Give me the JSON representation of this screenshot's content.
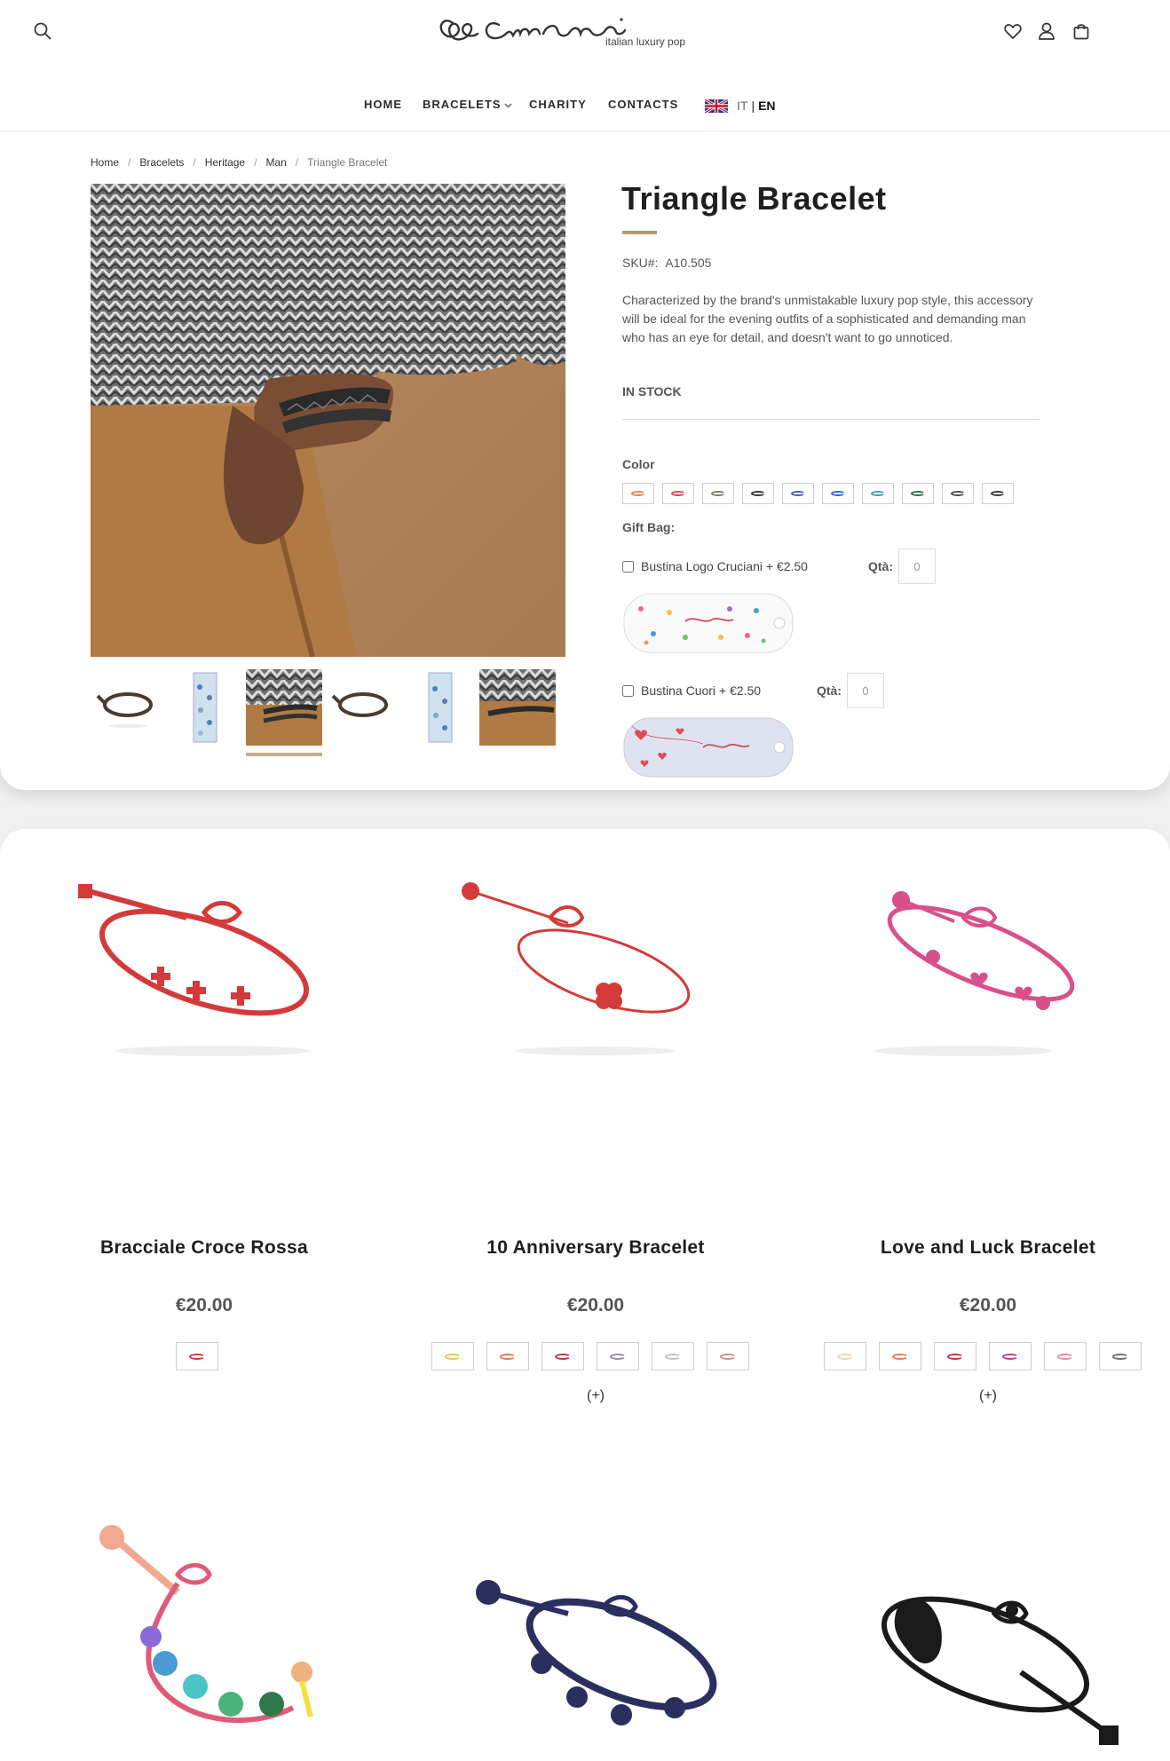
{
  "header": {
    "logo_text": "Cruciani",
    "logo_tagline": "italian luxury pop"
  },
  "nav": {
    "home": "HOME",
    "bracelets": "BRACELETS",
    "charity": "CHARITY",
    "contacts": "CONTACTS",
    "lang_it": "IT",
    "lang_sep": "|",
    "lang_en": "EN"
  },
  "breadcrumb": [
    "Home",
    "Bracelets",
    "Heritage",
    "Man",
    "Triangle Bracelet"
  ],
  "product": {
    "title": "Triangle Bracelet",
    "sku_label": "SKU#:",
    "sku_value": "A10.505",
    "description": "Characterized by the brand's unmistakable luxury pop style, this accessory will be ideal for the evening outfits of a sophisticated and demanding man who has an eye for detail, and doesn't want to go unnoticed.",
    "stock": "IN STOCK",
    "color_label": "Color",
    "colors": [
      "#e0894a",
      "#c94b5e",
      "#7b7b6a",
      "#333333",
      "#4a5aa8",
      "#2e66c4",
      "#3aa3a3",
      "#2f6b4d",
      "#4d4d4d",
      "#3a3a3a"
    ],
    "gift_label": "Gift Bag:",
    "gift_options": [
      {
        "label": "Bustina Logo Cruciani + €2.50",
        "qta_label": "Qtà:",
        "qta_value": "0"
      },
      {
        "label": "Bustina Cuori + €2.50",
        "qta_label": "Qtà:",
        "qta_value": "0"
      }
    ]
  },
  "related": [
    {
      "name": "Bracciale Croce Rossa",
      "price": "€20.00",
      "colors": [
        "#d43a3a"
      ],
      "more": ""
    },
    {
      "name": "10 Anniversary Bracelet",
      "price": "€20.00",
      "colors": [
        "#e8c64a",
        "#e07a5a",
        "#c8304a",
        "#9a8aa0",
        "#c9c1bd",
        "#d48a8a"
      ],
      "more": "(+)"
    },
    {
      "name": "Love and Luck Bracelet",
      "price": "€20.00",
      "colors": [
        "#f0d9a8",
        "#e07a5a",
        "#c8304a",
        "#c8388a",
        "#e88aa8",
        "#7a6a6a"
      ],
      "more": "(+)"
    }
  ]
}
